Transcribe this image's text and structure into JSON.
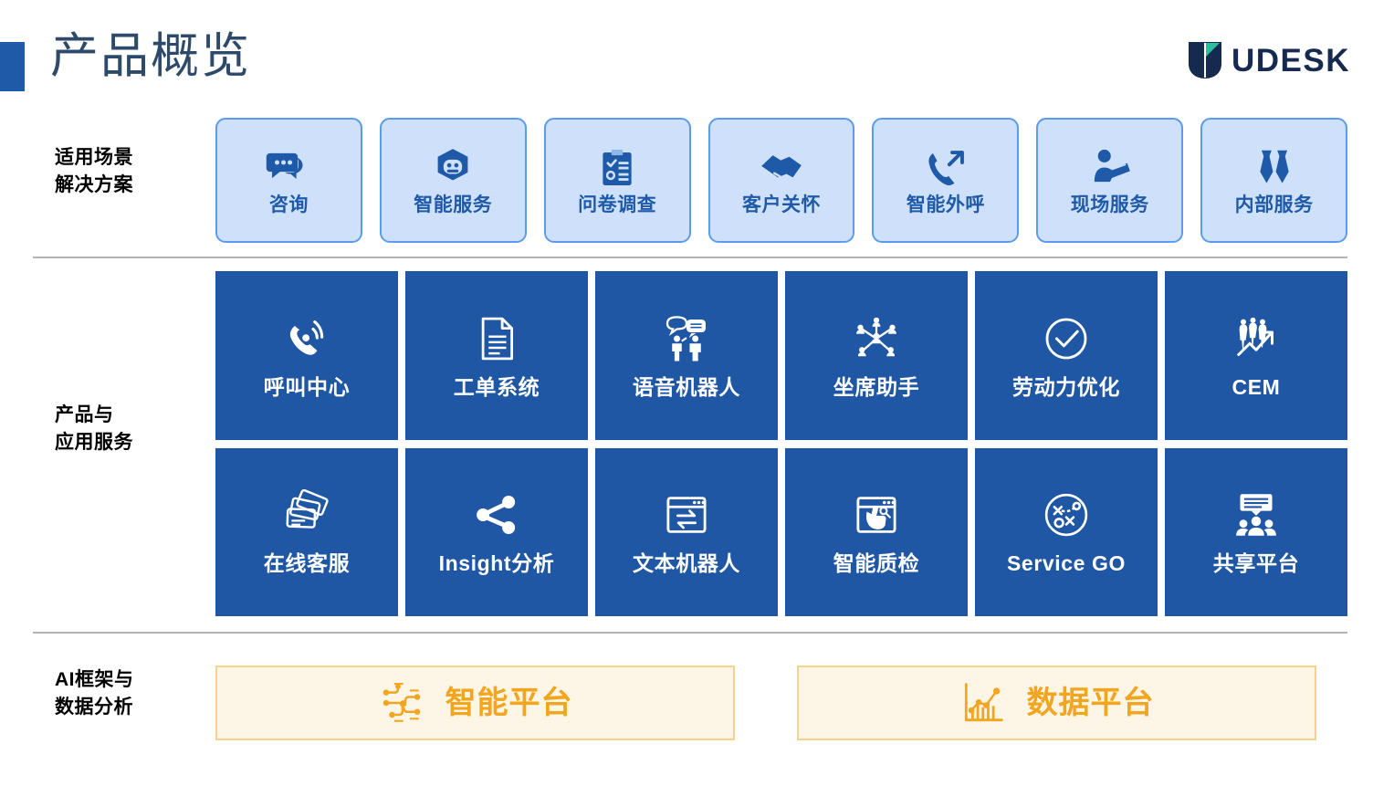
{
  "header": {
    "title": "产品概览",
    "logo_text": "UDESK",
    "logo_mark_name": "udesk-u-logo",
    "accent_color": "#1f5aa8",
    "title_color": "#2d4a6b",
    "logo_color": "#152a4e",
    "logo_accent_color": "#2bbfa0"
  },
  "rows": {
    "scenarios": {
      "label": "适用场景\n解决方案"
    },
    "products": {
      "label": "产品与\n应用服务"
    },
    "ai": {
      "label": "AI框架与\n数据分析"
    }
  },
  "colors": {
    "scenario_card_bg": "#cfe1fa",
    "scenario_card_border": "#5b9bec",
    "scenario_text": "#1f5aa8",
    "product_tile_bg": "#1f57a4",
    "product_text": "#ffffff",
    "platform_bg": "#fdf5e5",
    "platform_border": "#f6d38c",
    "platform_text": "#f2a51e",
    "divider": "#b3b3b3"
  },
  "scenarios": [
    {
      "label": "咨询",
      "icon": "chat-bubbles-icon"
    },
    {
      "label": "智能服务",
      "icon": "robot-icon"
    },
    {
      "label": "问卷调查",
      "icon": "clipboard-checklist-icon"
    },
    {
      "label": "客户关怀",
      "icon": "handshake-icon"
    },
    {
      "label": "智能外呼",
      "icon": "phone-outbound-icon"
    },
    {
      "label": "现场服务",
      "icon": "field-worker-icon"
    },
    {
      "label": "内部服务",
      "icon": "neckties-icon"
    }
  ],
  "products": [
    {
      "label": "呼叫中心",
      "icon": "phone-signal-icon"
    },
    {
      "label": "工单系统",
      "icon": "document-icon"
    },
    {
      "label": "语音机器人",
      "icon": "two-people-speech-icon"
    },
    {
      "label": "坐席助手",
      "icon": "network-people-icon"
    },
    {
      "label": "劳动力优化",
      "icon": "check-circle-icon"
    },
    {
      "label": "CEM",
      "icon": "people-growth-chart-icon"
    },
    {
      "label": "在线客服",
      "icon": "cards-icon"
    },
    {
      "label": "Insight分析",
      "icon": "share-nodes-icon"
    },
    {
      "label": "文本机器人",
      "icon": "window-exchange-icon"
    },
    {
      "label": "智能质检",
      "icon": "window-cursor-icon"
    },
    {
      "label": "Service GO",
      "icon": "strategy-circle-icon"
    },
    {
      "label": "共享平台",
      "icon": "presentation-group-icon"
    }
  ],
  "platforms": [
    {
      "label": "智能平台",
      "icon": "circuit-ai-icon"
    },
    {
      "label": "数据平台",
      "icon": "bar-line-chart-icon"
    }
  ]
}
